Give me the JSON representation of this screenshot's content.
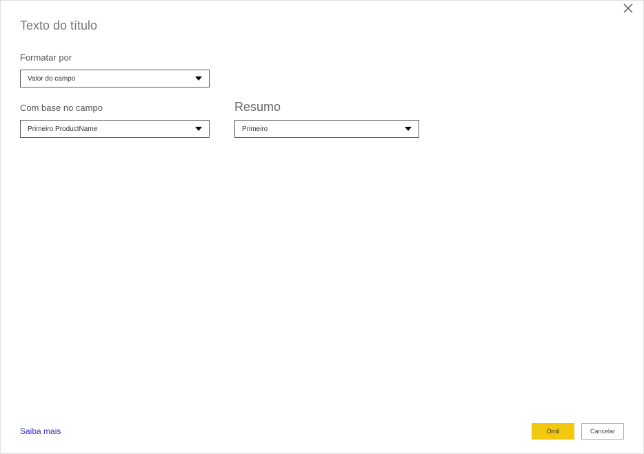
{
  "dialog": {
    "title": "Texto do título",
    "format_by_label": "Formatar por",
    "format_by_value": "Valor do campo",
    "based_on_field_label": "Com base no campo",
    "based_on_field_value": "Primeiro ProductName",
    "summary_label": "Resumo",
    "summary_value": "Primeiro",
    "learn_more": "Saiba mais",
    "ok_label": "Omil",
    "cancel_label": "Cancelar"
  }
}
